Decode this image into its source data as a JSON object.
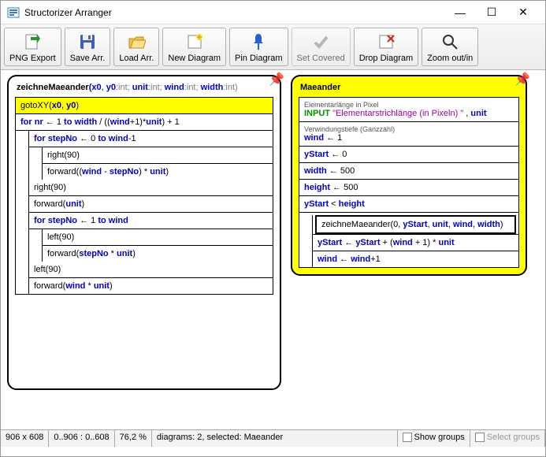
{
  "window": {
    "title": "Structorizer Arranger"
  },
  "toolbar": {
    "png_export": "PNG Export",
    "save_arr": "Save Arr.",
    "load_arr": "Load Arr.",
    "new_diagram": "New Diagram",
    "pin_diagram": "Pin Diagram",
    "set_covered": "Set Covered",
    "drop_diagram": "Drop Diagram",
    "zoom": "Zoom out/in"
  },
  "diag1": {
    "fn": "zeichneMaeander",
    "params": "(x0, y0:int; unit:int; wind:int; width:int)",
    "r_goto_a": "gotoXY(",
    "r_goto_b": "x0",
    "r_goto_c": ", ",
    "r_goto_d": "y0",
    "r_goto_e": ")",
    "for1_a": "for ",
    "for1_b": "nr",
    "for1_c": " ← 1 ",
    "for1_d": "to ",
    "for1_e": "width",
    "for1_f": " / ((",
    "for1_g": "wind",
    "for1_h": "+1)*",
    "for1_i": "unit",
    "for1_j": ") + 1",
    "for2_a": "for ",
    "for2_b": "stepNo",
    "for2_c": " ← 0 ",
    "for2_d": "to ",
    "for2_e": "wind",
    "for2_f": "-1",
    "right90": "right(90)",
    "fwd1_a": "forward((",
    "fwd1_b": "wind",
    "fwd1_c": " - ",
    "fwd1_d": "stepNo",
    "fwd1_e": ") * ",
    "fwd1_f": "unit",
    "fwd1_g": ")",
    "fwd2_a": "forward(",
    "fwd2_b": "unit",
    "fwd2_c": ")",
    "for3_a": "for ",
    "for3_b": "stepNo",
    "for3_c": " ← 1 ",
    "for3_d": "to ",
    "for3_e": "wind",
    "left90": "left(90)",
    "fwd3_a": "forward(",
    "fwd3_b": "stepNo",
    "fwd3_c": " * ",
    "fwd3_d": "unit",
    "fwd3_e": ")",
    "fwd4_a": "forward(",
    "fwd4_b": "wind",
    "fwd4_c": " * ",
    "fwd4_d": "unit",
    "fwd4_e": ")"
  },
  "diag2": {
    "title": "Maeander",
    "c1": "Elementarlänge in Pixel",
    "inp_kw": "INPUT",
    "inp_str": "\"Elementarstrichlänge (in Pixeln) \"",
    "inp_sep": " , ",
    "inp_var": "unit",
    "c2": "Verwindungstiefe (Ganzzahl)",
    "wind_a": "wind",
    "wind_b": " ← 1",
    "ys_a": "yStart",
    "ys_b": " ← 0",
    "w_a": "width",
    "w_b": " ← 500",
    "h_a": "height",
    "h_b": " ← 500",
    "cond_a": "yStart",
    "cond_b": " < ",
    "cond_c": "height",
    "call_a": "zeichneMaeander(0, ",
    "call_b": "yStart",
    "call_c": ", ",
    "call_d": "unit",
    "call_e": ", ",
    "call_f": "wind",
    "call_g": ", ",
    "call_h": "width",
    "call_i": ")",
    "upd_a": "yStart",
    "upd_b": " ← ",
    "upd_c": "yStart",
    "upd_d": " + (",
    "upd_e": "wind",
    "upd_f": " + 1) * ",
    "upd_g": "unit",
    "inc_a": "wind",
    "inc_b": " ← ",
    "inc_c": "wind",
    "inc_d": "+1"
  },
  "status": {
    "dims": "906 x 608",
    "range": "0..906 : 0..608",
    "zoom": "76,2 %",
    "info": "diagrams: 2, selected: Maeander",
    "show_groups": "Show groups",
    "select_groups": "Select groups"
  }
}
